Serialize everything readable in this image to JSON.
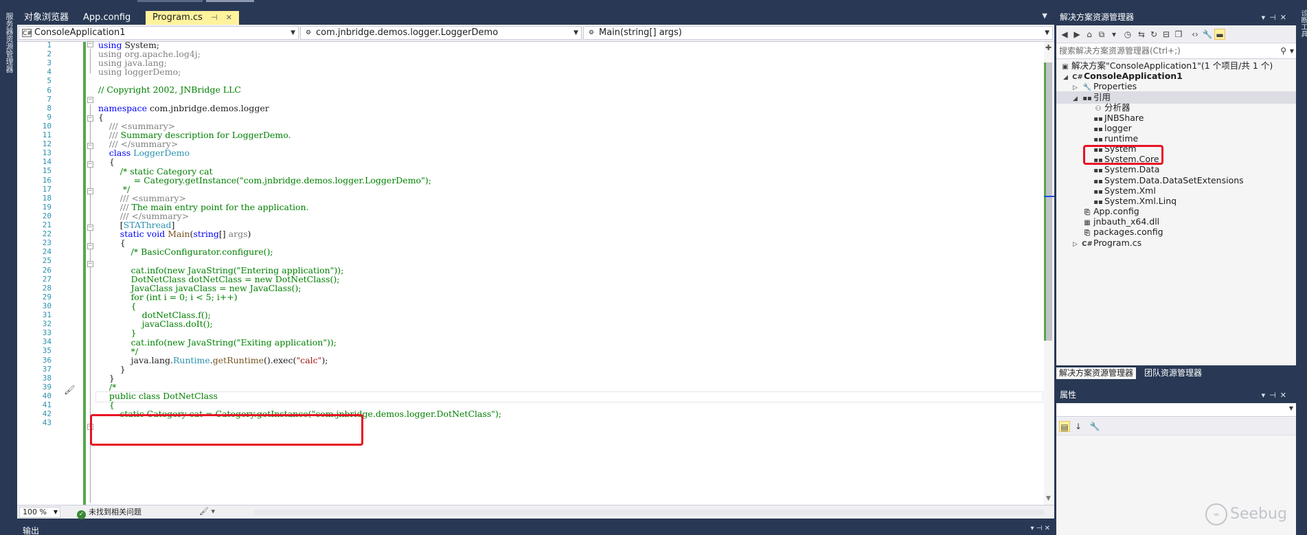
{
  "left_strip_label": "服务器资源管理器",
  "right_strip_label": "诊断工具",
  "editor_tabs": [
    {
      "label": "对象浏览器"
    },
    {
      "label": "App.config"
    },
    {
      "label": "Program.cs",
      "pin": "⊣",
      "close": "✕"
    }
  ],
  "navbar": {
    "project": "ConsoleApplication1",
    "project_icon": "C#",
    "class": "com.jnbridge.demos.logger.LoggerDemo",
    "member": "Main(string[] args)"
  },
  "line_numbers": [
    "1",
    "2",
    "3",
    "4",
    "5",
    "6",
    "7",
    "8",
    "9",
    "10",
    "11",
    "12",
    "13",
    "14",
    "15",
    "16",
    "17",
    "18",
    "19",
    "20",
    "21",
    "22",
    "23",
    "24",
    "25",
    "26",
    "27",
    "28",
    "29",
    "30",
    "31",
    "32",
    "33",
    "34",
    "35",
    "36",
    "37",
    "38",
    "39",
    "40",
    "41",
    "42",
    "43"
  ],
  "code": {
    "l1a": "using",
    "l1b": " System;",
    "l2": "using org.apache.log4j;",
    "l3": "using java.lang;",
    "l4": "using loggerDemo;",
    "l6": "// Copyright 2002, JNBridge LLC",
    "l8a": "namespace",
    "l8b": " com.jnbridge.demos.logger",
    "l9": "{",
    "l10": "    /// <summary>",
    "l11a": "    ///",
    "l11b": " Summary description for LoggerDemo.",
    "l12": "    /// </summary>",
    "l13a": "    class",
    "l13b": " LoggerDemo",
    "l14": "    {",
    "l15": "        /* static Category cat",
    "l16": "             = Category.getInstance(\"com.jnbridge.demos.logger.LoggerDemo\");",
    "l17": "         */",
    "l18": "        /// <summary>",
    "l19a": "        ///",
    "l19b": " The main entry point for the application.",
    "l20": "        /// </summary>",
    "l21a": "        [",
    "l21b": "STAThread",
    "l21c": "]",
    "l22a": "        static void",
    "l22b": " Main",
    "l22c": "(",
    "l22d": "string",
    "l22e": "[] ",
    "l22f": "args",
    "l22g": ")",
    "l23": "        {",
    "l24": "            /* BasicConfigurator.configure();",
    "l26": "            cat.info(new JavaString(\"Entering application\"));",
    "l27": "            DotNetClass dotNetClass = new DotNetClass();",
    "l28": "            JavaClass javaClass = new JavaClass();",
    "l29": "            for (int i = 0; i < 5; i++)",
    "l30": "            {",
    "l31": "                dotNetClass.f();",
    "l32": "                javaClass.doIt();",
    "l33": "            }",
    "l34": "            cat.info(new JavaString(\"Exiting application\"));",
    "l35": "            */",
    "l36a": "            java.lang.",
    "l36b": "Runtime",
    "l36c": ".",
    "l36d": "getRuntime",
    "l36e": "().exec(",
    "l36f": "\"calc\"",
    "l36g": ");",
    "l37": "        }",
    "l38": "    }",
    "l39": "    /*",
    "l40": "    public class DotNetClass",
    "l41": "    {",
    "l42": "        static Category cat = Category.getInstance(\"com.jnbridge.demos.logger.DotNetClass\");"
  },
  "status": {
    "zoom": "100 %",
    "issues": "未找到相关问题"
  },
  "output_panel": {
    "title": "输出"
  },
  "solution_explorer": {
    "title": "解决方案资源管理器",
    "search_placeholder": "搜索解决方案资源管理器(Ctrl+;)",
    "items": [
      {
        "label": "解决方案\"ConsoleApplication1\"(1 个项目/共 1 个)"
      },
      {
        "label": "ConsoleApplication1"
      },
      {
        "label": "Properties"
      },
      {
        "label": "引用"
      },
      {
        "label": "分析器"
      },
      {
        "label": "JNBShare"
      },
      {
        "label": "logger"
      },
      {
        "label": "runtime"
      },
      {
        "label": "System"
      },
      {
        "label": "System.Core"
      },
      {
        "label": "System.Data"
      },
      {
        "label": "System.Data.DataSetExtensions"
      },
      {
        "label": "System.Xml"
      },
      {
        "label": "System.Xml.Linq"
      },
      {
        "label": "App.config"
      },
      {
        "label": "jnbauth_x64.dll"
      },
      {
        "label": "packages.config"
      },
      {
        "label": "Program.cs"
      }
    ],
    "tabs": [
      {
        "label": "解决方案资源管理器"
      },
      {
        "label": "团队资源管理器"
      }
    ]
  },
  "properties_panel": {
    "title": "属性"
  },
  "watermark": "Seebug",
  "colors": {
    "accent_tab": "#fff29d",
    "chrome": "#293955",
    "annotation": "#e81123"
  }
}
